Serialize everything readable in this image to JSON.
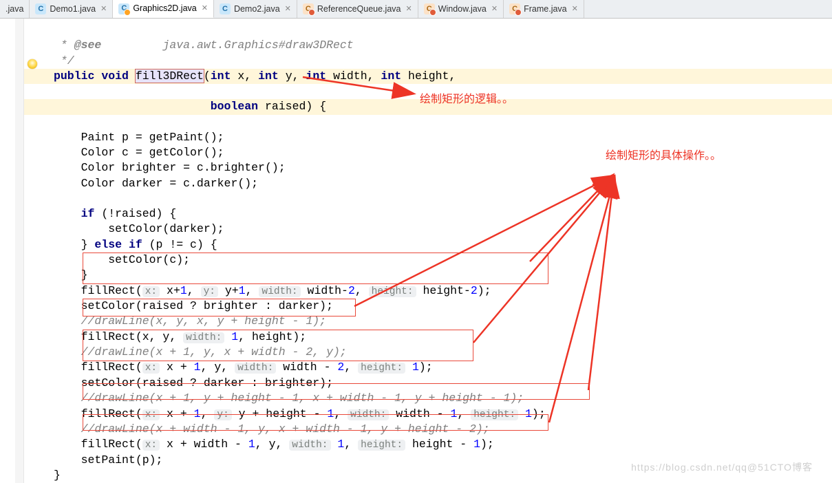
{
  "tabs": [
    {
      "label": ".java"
    },
    {
      "label": "Demo1.java"
    },
    {
      "label": "Graphics2D.java"
    },
    {
      "label": "Demo2.java"
    },
    {
      "label": "ReferenceQueue.java"
    },
    {
      "label": "Window.java"
    },
    {
      "label": "Frame.java"
    }
  ],
  "annotations": {
    "logic": "绘制矩形的逻辑。。",
    "ops": "绘制矩形的具体操作。。"
  },
  "doc": {
    "see": "@see",
    "link": "java.awt.Graphics#draw3DRect",
    "close": "*/"
  },
  "code": {
    "public": "public",
    "void": "void",
    "method": "fill3DRect",
    "int": "int",
    "boolean": "boolean",
    "param_x": "x",
    "param_y": "y",
    "param_width": "width",
    "param_height": "height",
    "param_raised": "raised",
    "l_p_decl": "Paint p = getPaint();",
    "l_c_decl": "Color c = getColor();",
    "l_brighter": "Color brighter = c.brighter();",
    "l_darker": "Color darker = c.darker();",
    "if": "if",
    "else": "else",
    "cond_not_raised": "(!raised) {",
    "set_darker": "setColor(darker);",
    "close_else": "} ",
    "elseif_cond": " (p != c) {",
    "set_c": "setColor(c);",
    "close_brace": "}",
    "fillRect": "fillRect(",
    "hint_x": "x:",
    "hint_y": "y:",
    "hint_width": "width:",
    "hint_height": "height:",
    "fr1_xv": " x+",
    "fr1_yv": " y+",
    "fr1_wv": " width-",
    "fr1_hv": " height-",
    "num1": "1",
    "num2": "2",
    "set_raised_bd": "setColor(raised ? brighter : darker);",
    "c_dl1": "//drawLine(x, y, x, y + height - 1);",
    "fr2": "fillRect(x, y, ",
    "fr2_end": ", height);",
    "c_dl2": "//drawLine(x + 1, y, x + width - 2, y);",
    "fr3_xv": " x + ",
    "fr3_rest": ", y, ",
    "fr3_wv": " width - ",
    "fr3_end": ");",
    "set_raised_db": "setColor(raised ? darker : brighter);",
    "c_dl3": "//drawLine(x + 1, y + height - 1, x + width - 1, y + height - 1);",
    "fr4_yv": " y + height - ",
    "fr4_wv": " width - ",
    "c_dl4": "//drawLine(x + width - 1, y, x + width - 1, y + height - 2);",
    "fr5_xv": " x + width - ",
    "fr5_rest": ", y, ",
    "fr5_hv": " height - ",
    "setpaint": "setPaint(p);"
  },
  "footer": "https://blog.csdn.net/qq@51CTO博客"
}
